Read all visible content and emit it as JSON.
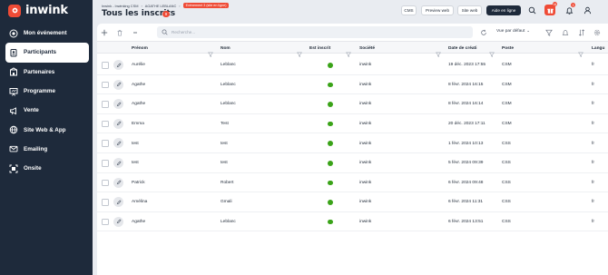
{
  "app": {
    "logo_text": "inwink",
    "brand_color": "#ef4b36",
    "sidebar_color": "#1e2a3b"
  },
  "sidebar": {
    "items": [
      {
        "label": "Mon événement",
        "icon": "target-icon",
        "active": false
      },
      {
        "label": "Participants",
        "icon": "badge-icon",
        "active": true
      },
      {
        "label": "Partenaires",
        "icon": "building-icon",
        "active": false
      },
      {
        "label": "Programme",
        "icon": "presentation-icon",
        "active": false
      },
      {
        "label": "Vente",
        "icon": "megaphone-icon",
        "active": false
      },
      {
        "label": "Site Web & App",
        "icon": "globe-icon",
        "active": false
      },
      {
        "label": "Emailing",
        "icon": "mail-icon",
        "active": false
      },
      {
        "label": "Onsite",
        "icon": "scan-icon",
        "active": false
      }
    ]
  },
  "header": {
    "breadcrumb": [
      "Inwink - Inwinking CSM",
      "AGATHE LEBLANC"
    ],
    "event_badge": "Evénement 3 (site en ligne)",
    "title": "Tous les inscrits",
    "count": "9",
    "buttons": {
      "cms": "CMS",
      "preview": "Preview web",
      "site": "Site web",
      "help": "Aide en ligne"
    },
    "gift_badge": "44",
    "bell_badge": "3"
  },
  "toolbar": {
    "search_placeholder": "Recherche...",
    "view_label": "Vue par défaut"
  },
  "table": {
    "columns": [
      "Prénom",
      "Nom",
      "Est inscrit",
      "Société",
      "Date de créati",
      "Poste",
      "Langu"
    ],
    "rows": [
      {
        "prenom": "Aurélie",
        "nom": "Leblanc",
        "societe": "inwink",
        "date": "19 déc. 2023 17:55",
        "poste": "CSM",
        "langue": "fr"
      },
      {
        "prenom": "Agathe",
        "nom": "Leblanc",
        "societe": "inwink",
        "date": "8 févr. 2024 16:15",
        "poste": "CSM",
        "langue": "fr"
      },
      {
        "prenom": "Agathe",
        "nom": "Leblanc",
        "societe": "inwink",
        "date": "8 févr. 2024 16:14",
        "poste": "CSM",
        "langue": "fr"
      },
      {
        "prenom": "Emma",
        "nom": "Test",
        "societe": "inwink",
        "date": "20 déc. 2023 17:11",
        "poste": "CSM",
        "langue": "fr"
      },
      {
        "prenom": "test",
        "nom": "test",
        "societe": "inwink",
        "date": "1 févr. 2024 10:13",
        "poste": "CSS",
        "langue": "fr"
      },
      {
        "prenom": "test",
        "nom": "test",
        "societe": "inwink",
        "date": "5 févr. 2024 09:39",
        "poste": "CSS",
        "langue": "fr"
      },
      {
        "prenom": "Patrick",
        "nom": "Robert",
        "societe": "inwink",
        "date": "6 févr. 2024 09:48",
        "poste": "CSS",
        "langue": "fr"
      },
      {
        "prenom": "Amélina",
        "nom": "Gmali",
        "societe": "inwink",
        "date": "6 févr. 2024 11:31",
        "poste": "CSS",
        "langue": "fr"
      },
      {
        "prenom": "Agathe",
        "nom": "Leblanc",
        "societe": "inwink",
        "date": "6 févr. 2024 13:51",
        "poste": "CSS",
        "langue": "fr"
      }
    ]
  }
}
